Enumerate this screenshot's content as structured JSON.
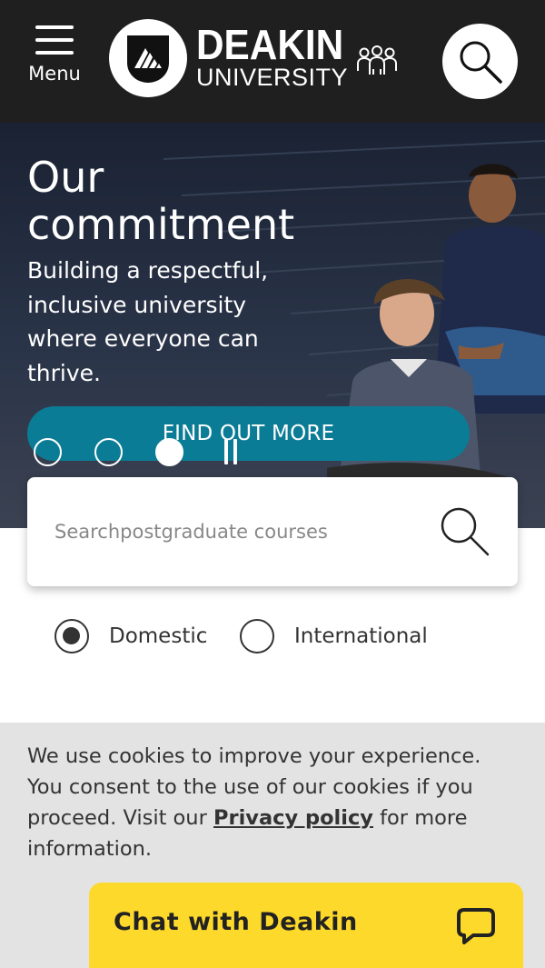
{
  "header": {
    "menu_label": "Menu",
    "logo_line1": "DEAKIN",
    "logo_line2": "UNIVERSITY",
    "icons": [
      "menu-icon",
      "deakin-logo",
      "people-icon",
      "search-icon"
    ]
  },
  "hero": {
    "title": "Our commitment",
    "subtitle": "Building a respectful, inclusive university where everyone can thrive.",
    "cta_label": "FIND OUT MORE",
    "slides": 3,
    "active_slide": 3
  },
  "search": {
    "placeholder": "Searchpostgraduate courses"
  },
  "student_type": {
    "options": [
      "Domestic",
      "International"
    ],
    "selected": "Domestic"
  },
  "cookie": {
    "text_before": "We use cookies to improve your experience. You consent to the use of our cookies if you proceed. Visit our ",
    "link": "Privacy policy",
    "text_after": " for more information."
  },
  "chat": {
    "label": "Chat with Deakin"
  },
  "colors": {
    "header_bg": "#1f1f1f",
    "cta_bg": "#0b7c96",
    "chat_bg": "#fdd92b",
    "cookie_bg": "#e3e3e3"
  }
}
